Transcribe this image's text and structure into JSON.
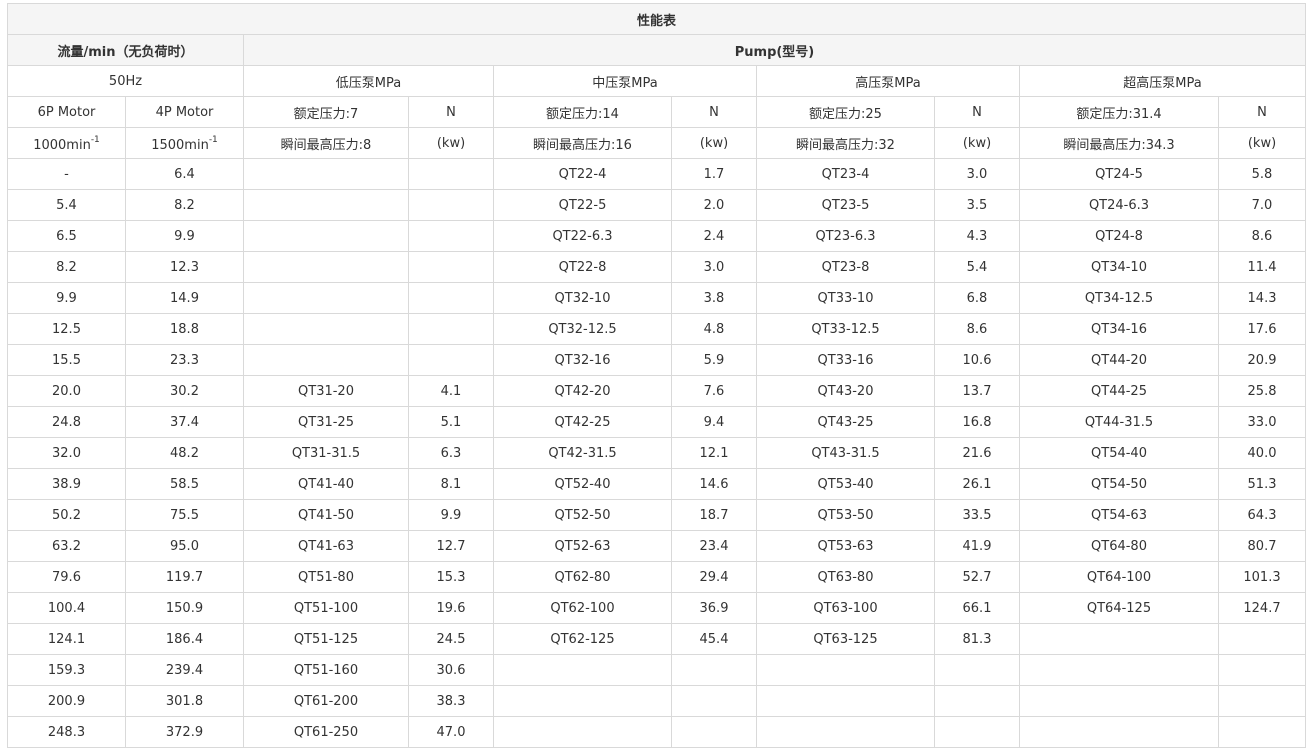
{
  "title": "性能表",
  "group_headers": {
    "flow": "流量/min（无负荷时）",
    "pump": "Pump(型号)"
  },
  "sub_headers": {
    "freq": "50Hz",
    "low": "低压泵MPa",
    "mid": "中压泵MPa",
    "high": "高压泵MPa",
    "ultra": "超高压泵MPa"
  },
  "row3": {
    "motor6": "6P Motor",
    "motor4": "4P Motor",
    "low_rated": "额定压力:7",
    "low_n": "N",
    "mid_rated": "额定压力:14",
    "mid_n": "N",
    "high_rated": "额定压力:25",
    "high_n": "N",
    "ultra_rated": "额定压力:31.4",
    "ultra_n": "N"
  },
  "row4": {
    "rpm6": "1000min",
    "rpm6_sup": "-1",
    "rpm4": "1500min",
    "rpm4_sup": "-1",
    "low_peak": "瞬间最高压力:8",
    "low_kw": "(kw)",
    "mid_peak": "瞬间最高压力:16",
    "mid_kw": "(kw)",
    "high_peak": "瞬间最高压力:32",
    "high_kw": "(kw)",
    "ultra_peak": "瞬间最高压力:34.3",
    "ultra_kw": "(kw)"
  },
  "rows": [
    [
      "-",
      "6.4",
      "",
      "",
      "QT22-4",
      "1.7",
      "QT23-4",
      "3.0",
      "QT24-5",
      "5.8"
    ],
    [
      "5.4",
      "8.2",
      "",
      "",
      "QT22-5",
      "2.0",
      "QT23-5",
      "3.5",
      "QT24-6.3",
      "7.0"
    ],
    [
      "6.5",
      "9.9",
      "",
      "",
      "QT22-6.3",
      "2.4",
      "QT23-6.3",
      "4.3",
      "QT24-8",
      "8.6"
    ],
    [
      "8.2",
      "12.3",
      "",
      "",
      "QT22-8",
      "3.0",
      "QT23-8",
      "5.4",
      "QT34-10",
      "11.4"
    ],
    [
      "9.9",
      "14.9",
      "",
      "",
      "QT32-10",
      "3.8",
      "QT33-10",
      "6.8",
      "QT34-12.5",
      "14.3"
    ],
    [
      "12.5",
      "18.8",
      "",
      "",
      "QT32-12.5",
      "4.8",
      "QT33-12.5",
      "8.6",
      "QT34-16",
      "17.6"
    ],
    [
      "15.5",
      "23.3",
      "",
      "",
      "QT32-16",
      "5.9",
      "QT33-16",
      "10.6",
      "QT44-20",
      "20.9"
    ],
    [
      "20.0",
      "30.2",
      "QT31-20",
      "4.1",
      "QT42-20",
      "7.6",
      "QT43-20",
      "13.7",
      "QT44-25",
      "25.8"
    ],
    [
      "24.8",
      "37.4",
      "QT31-25",
      "5.1",
      "QT42-25",
      "9.4",
      "QT43-25",
      "16.8",
      "QT44-31.5",
      "33.0"
    ],
    [
      "32.0",
      "48.2",
      "QT31-31.5",
      "6.3",
      "QT42-31.5",
      "12.1",
      "QT43-31.5",
      "21.6",
      "QT54-40",
      "40.0"
    ],
    [
      "38.9",
      "58.5",
      "QT41-40",
      "8.1",
      "QT52-40",
      "14.6",
      "QT53-40",
      "26.1",
      "QT54-50",
      "51.3"
    ],
    [
      "50.2",
      "75.5",
      "QT41-50",
      "9.9",
      "QT52-50",
      "18.7",
      "QT53-50",
      "33.5",
      "QT54-63",
      "64.3"
    ],
    [
      "63.2",
      "95.0",
      "QT41-63",
      "12.7",
      "QT52-63",
      "23.4",
      "QT53-63",
      "41.9",
      "QT64-80",
      "80.7"
    ],
    [
      "79.6",
      "119.7",
      "QT51-80",
      "15.3",
      "QT62-80",
      "29.4",
      "QT63-80",
      "52.7",
      "QT64-100",
      "101.3"
    ],
    [
      "100.4",
      "150.9",
      "QT51-100",
      "19.6",
      "QT62-100",
      "36.9",
      "QT63-100",
      "66.1",
      "QT64-125",
      "124.7"
    ],
    [
      "124.1",
      "186.4",
      "QT51-125",
      "24.5",
      "QT62-125",
      "45.4",
      "QT63-125",
      "81.3",
      "",
      ""
    ],
    [
      "159.3",
      "239.4",
      "QT51-160",
      "30.6",
      "",
      "",
      "",
      "",
      "",
      ""
    ],
    [
      "200.9",
      "301.8",
      "QT61-200",
      "38.3",
      "",
      "",
      "",
      "",
      "",
      ""
    ],
    [
      "248.3",
      "372.9",
      "QT61-250",
      "47.0",
      "",
      "",
      "",
      "",
      "",
      ""
    ]
  ]
}
